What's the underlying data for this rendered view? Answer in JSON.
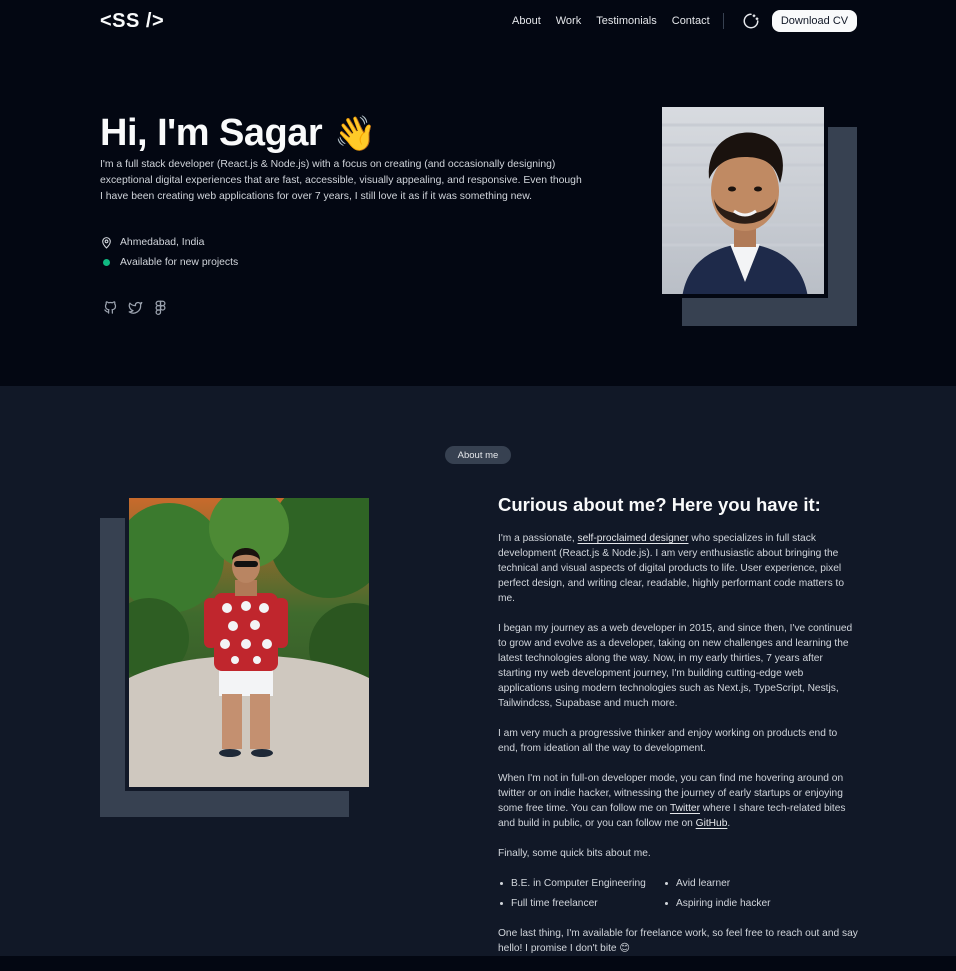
{
  "header": {
    "logo": "<SS />",
    "nav": [
      "About",
      "Work",
      "Testimonials",
      "Contact"
    ],
    "cv_button": "Download CV"
  },
  "hero": {
    "title": "Hi, I'm Sagar",
    "wave_emoji": "👋",
    "description": "I'm a full stack developer (React.js & Node.js) with a focus on creating (and occasionally designing) exceptional digital experiences that are fast, accessible, visually appealing, and responsive. Even though I have been creating web applications for over 7 years, I still love it as if it was something new.",
    "location": "Ahmedabad, India",
    "availability": "Available for new projects",
    "socials": [
      "github-icon",
      "twitter-icon",
      "figma-icon"
    ]
  },
  "about": {
    "chip": "About me",
    "title": "Curious about me? Here you have it:",
    "p1_a": "I'm a passionate, ",
    "p1_link": "self-proclaimed designer",
    "p1_b": " who specializes in full stack development (React.js & Node.js). I am very enthusiastic about bringing the technical and visual aspects of digital products to life. User experience, pixel perfect design, and writing clear, readable, highly performant code matters to me.",
    "p2": "I began my journey as a web developer in 2015, and since then, I've continued to grow and evolve as a developer, taking on new challenges and learning the latest technologies along the way. Now, in my early thirties, 7 years after starting my web development journey, I'm building cutting-edge web applications using modern technologies such as Next.js, TypeScript, Nestjs, Tailwindcss, Supabase and much more.",
    "p3": "I am very much a progressive thinker and enjoy working on products end to end, from ideation all the way to development.",
    "p4_a": "When I'm not in full-on developer mode, you can find me hovering around on twitter or on indie hacker, witnessing the journey of early startups or enjoying some free time. You can follow me on ",
    "p4_link1": "Twitter",
    "p4_b": " where I share tech-related bites and build in public, or you can follow me on ",
    "p4_link2": "GitHub",
    "p4_c": ".",
    "p5": "Finally, some quick bits about me.",
    "bits": [
      "B.E. in Computer Engineering",
      "Avid learner",
      "Full time freelancer",
      "Aspiring indie hacker"
    ],
    "p6": "One last thing, I'm available for freelance work, so feel free to reach out and say hello! I promise I don't bite 😊"
  },
  "colors": {
    "bg_dark": "#030712",
    "bg_section": "#111827",
    "accent_green": "#10b981",
    "frame_gray": "#374151"
  }
}
